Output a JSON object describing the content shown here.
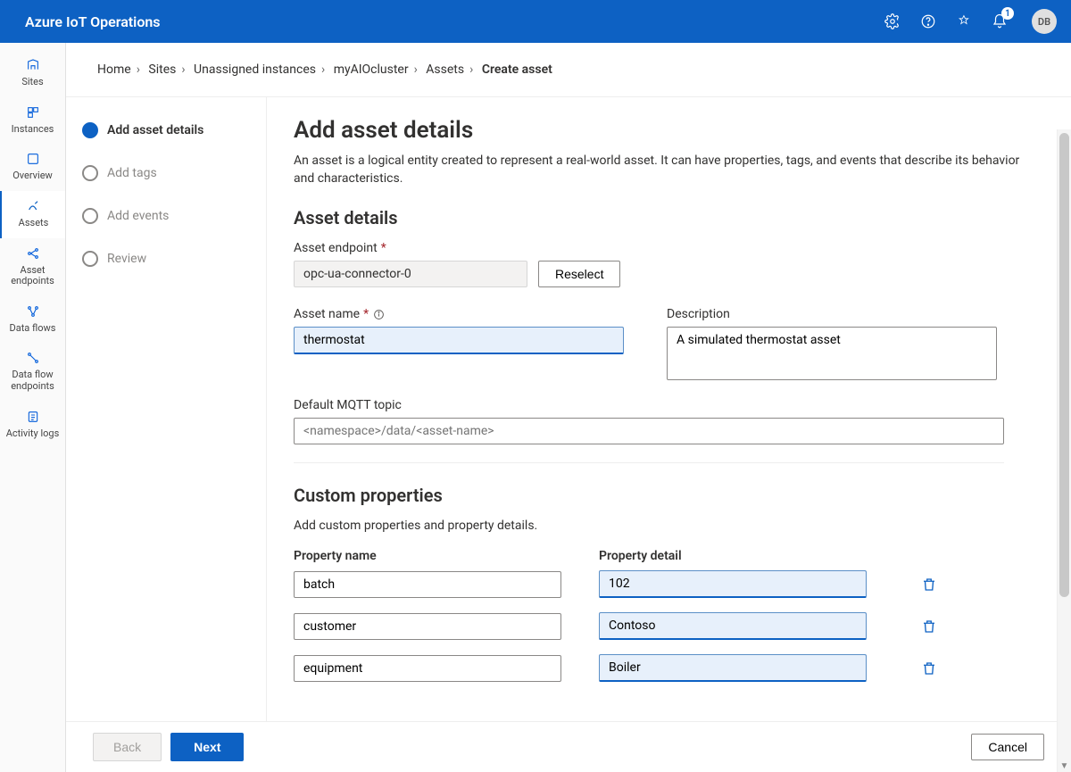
{
  "header": {
    "title": "Azure IoT Operations",
    "notification_count": "1",
    "avatar_initials": "DB"
  },
  "sidebar": {
    "items": [
      {
        "label": "Sites"
      },
      {
        "label": "Instances"
      },
      {
        "label": "Overview"
      },
      {
        "label": "Assets"
      },
      {
        "label": "Asset endpoints"
      },
      {
        "label": "Data flows"
      },
      {
        "label": "Data flow endpoints"
      },
      {
        "label": "Activity logs"
      }
    ]
  },
  "breadcrumb": {
    "items": [
      "Home",
      "Sites",
      "Unassigned instances",
      "myAIOcluster",
      "Assets"
    ],
    "current": "Create asset"
  },
  "wizard": {
    "steps": [
      {
        "label": "Add asset details"
      },
      {
        "label": "Add tags"
      },
      {
        "label": "Add events"
      },
      {
        "label": "Review"
      }
    ]
  },
  "form": {
    "heading": "Add asset details",
    "intro": "An asset is a logical entity created to represent a real-world asset. It can have properties, tags, and events that describe its behavior and characteristics.",
    "section_details": "Asset details",
    "endpoint_label": "Asset endpoint",
    "endpoint_value": "opc-ua-connector-0",
    "reselect": "Reselect",
    "name_label": "Asset name",
    "name_value": "thermostat",
    "desc_label": "Description",
    "desc_value": "A simulated thermostat asset",
    "mqtt_label": "Default MQTT topic",
    "mqtt_placeholder": "<namespace>/data/<asset-name>",
    "section_custom": "Custom properties",
    "custom_sub": "Add custom properties and property details.",
    "col_name": "Property name",
    "col_detail": "Property detail",
    "properties": [
      {
        "name": "batch",
        "detail": "102"
      },
      {
        "name": "customer",
        "detail": "Contoso"
      },
      {
        "name": "equipment",
        "detail": "Boiler"
      }
    ]
  },
  "footer": {
    "back": "Back",
    "next": "Next",
    "cancel": "Cancel"
  }
}
